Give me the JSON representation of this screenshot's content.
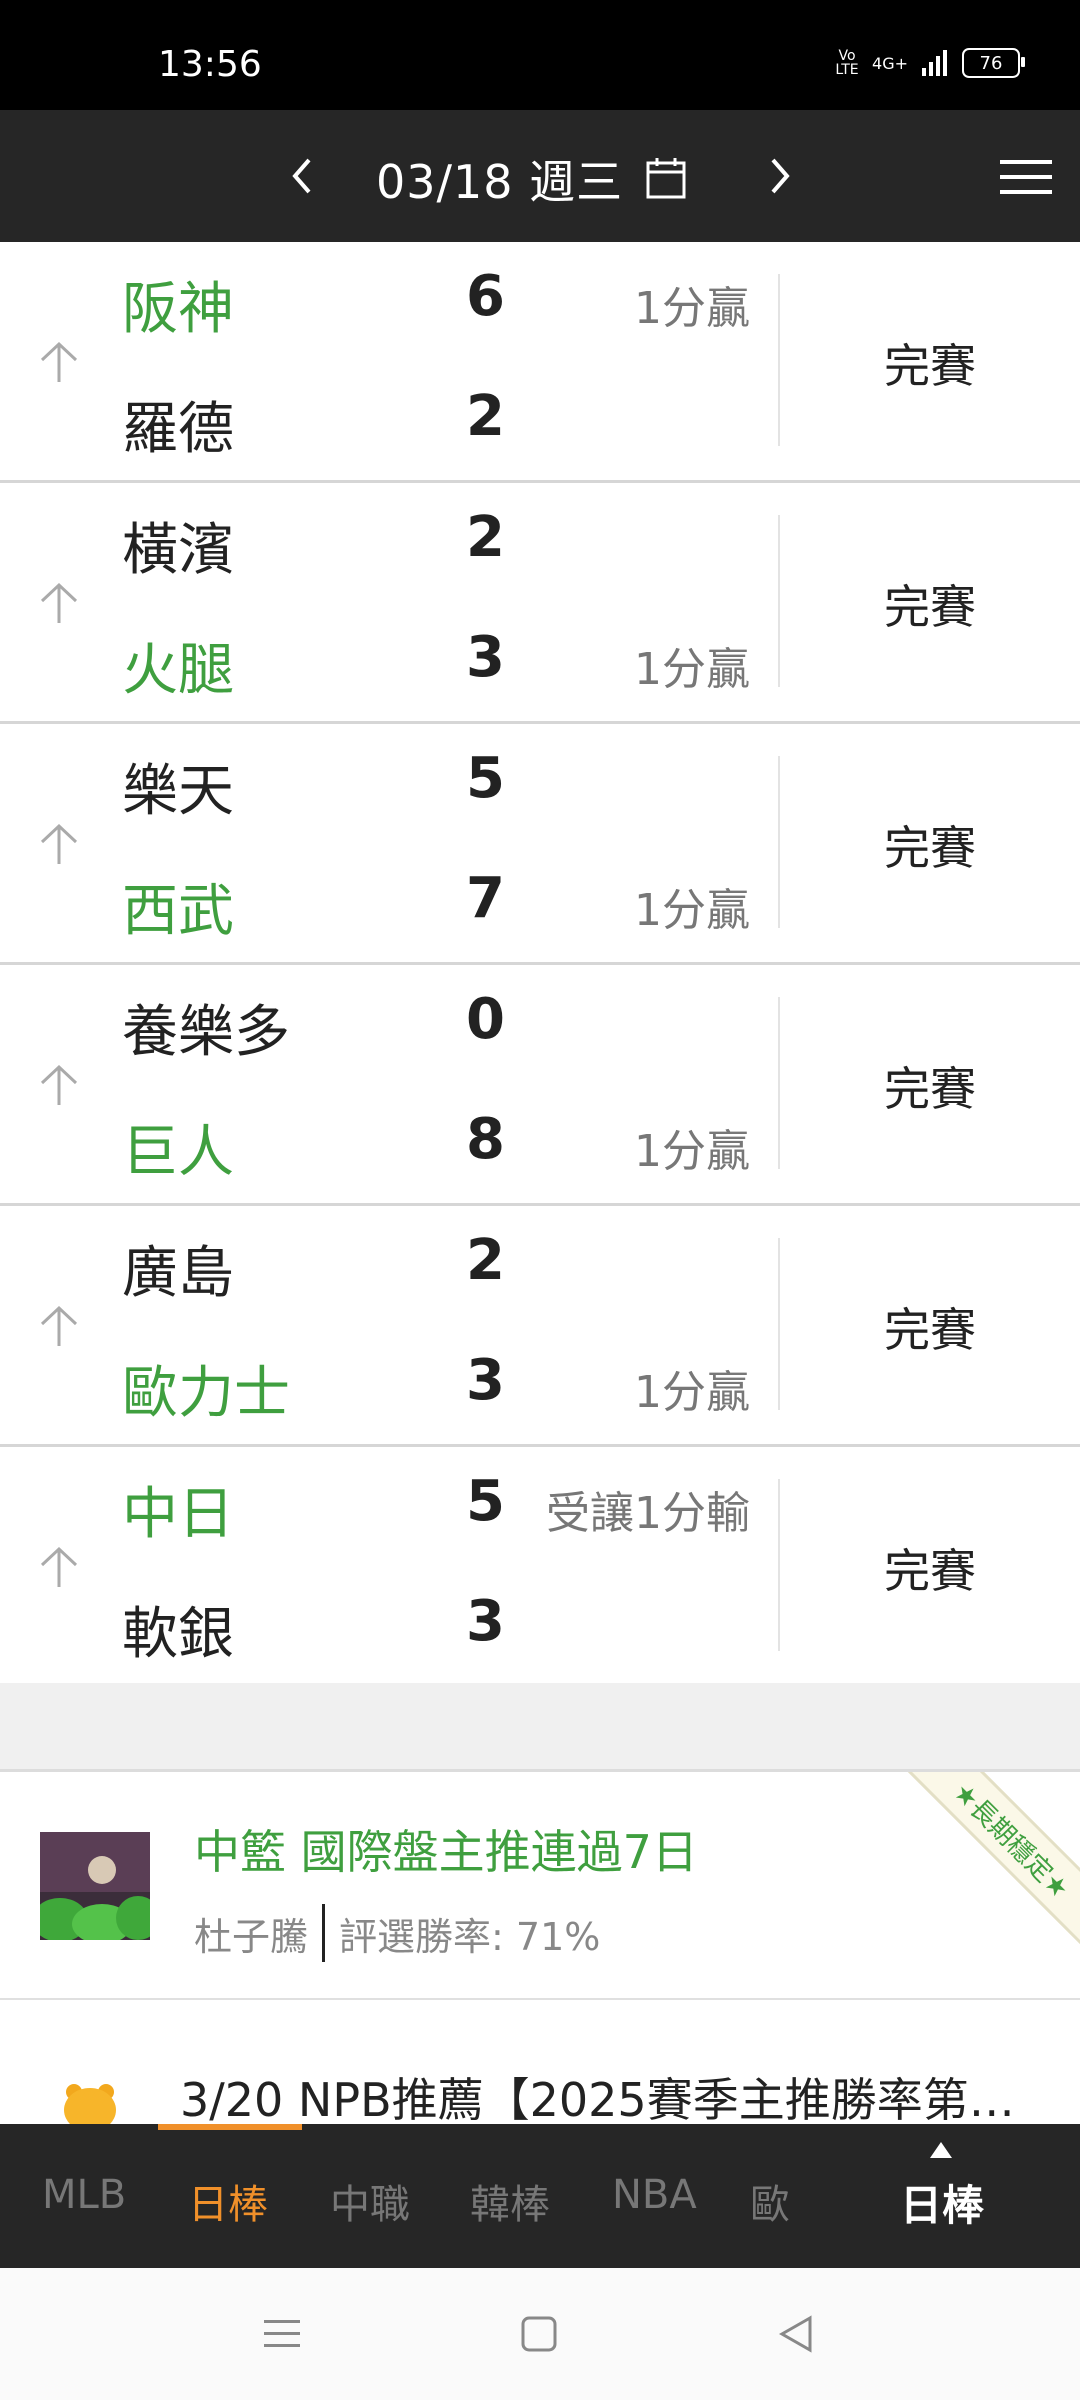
{
  "status_bar": {
    "time": "13:56",
    "network_volte": "Vo LTE",
    "network_type": "4G+",
    "battery": "76"
  },
  "date_bar": {
    "date_label": "03/18 週三"
  },
  "games": [
    {
      "away": "阪神",
      "home": "羅德",
      "away_score": "6",
      "home_score": "2",
      "away_result": "1分贏",
      "home_result": "",
      "winner": "away",
      "status": "完賽"
    },
    {
      "away": "橫濱",
      "home": "火腿",
      "away_score": "2",
      "home_score": "3",
      "away_result": "",
      "home_result": "1分贏",
      "winner": "home",
      "status": "完賽"
    },
    {
      "away": "樂天",
      "home": "西武",
      "away_score": "5",
      "home_score": "7",
      "away_result": "",
      "home_result": "1分贏",
      "winner": "home",
      "status": "完賽"
    },
    {
      "away": "養樂多",
      "home": "巨人",
      "away_score": "0",
      "home_score": "8",
      "away_result": "",
      "home_result": "1分贏",
      "winner": "home",
      "status": "完賽"
    },
    {
      "away": "廣島",
      "home": "歐力士",
      "away_score": "2",
      "home_score": "3",
      "away_result": "",
      "home_result": "1分贏",
      "winner": "home",
      "status": "完賽"
    },
    {
      "away": "中日",
      "home": "軟銀",
      "away_score": "5",
      "home_score": "3",
      "away_result": "受讓1分輸",
      "home_result": "",
      "winner": "away",
      "status": "完賽"
    }
  ],
  "promo": {
    "title": "中籃 國際盤主推連過7日",
    "author": "杜子騰",
    "win_rate": "評選勝率: 71%",
    "ribbon": "★長期穩定★"
  },
  "article": {
    "title": "3/20 NPB推薦【2025賽季主推勝率第1..."
  },
  "tabs": [
    {
      "label": "MLB",
      "active": false
    },
    {
      "label": "日棒",
      "active": true
    },
    {
      "label": "中職",
      "active": false
    },
    {
      "label": "韓棒",
      "active": false
    },
    {
      "label": "NBA",
      "active": false
    },
    {
      "label": "歐",
      "active": false
    }
  ],
  "tab_current": "日棒",
  "colors": {
    "win_green": "#3f9f3f",
    "accent_orange": "#f0902a",
    "header_bg": "#262626"
  }
}
